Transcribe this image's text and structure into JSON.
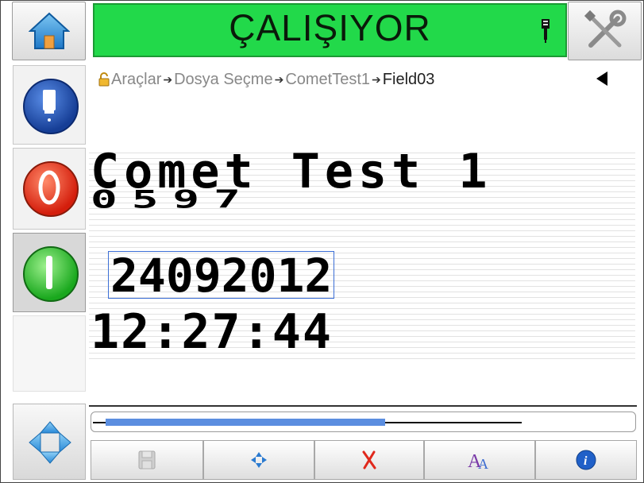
{
  "header": {
    "status_text": "ÇALIŞIYOR",
    "status_color": "#22d94a"
  },
  "breadcrumb": {
    "items": [
      "Araçlar",
      "Dosya Seçme",
      "CometTest1",
      "Field03"
    ]
  },
  "message": {
    "line1": "Comet Test 1",
    "line2": "0597",
    "line3_selected": "24092012",
    "line4": "12:27:44"
  },
  "scrollbar": {
    "position_fraction": 0.5
  },
  "colors": {
    "accent_blue": "#3c6fd6",
    "stop_red": "#e8321e",
    "start_green": "#22c52a",
    "ink_blue": "#1e50b4"
  },
  "icons": {
    "home": "home-icon",
    "tools": "tools-icon",
    "ink": "ink-bottle-icon",
    "stop": "stop-icon",
    "start": "start-icon",
    "nav": "direction-pad-icon",
    "save": "save-icon",
    "move": "move-icon",
    "delete": "delete-icon",
    "font": "font-icon",
    "info": "info-icon"
  }
}
